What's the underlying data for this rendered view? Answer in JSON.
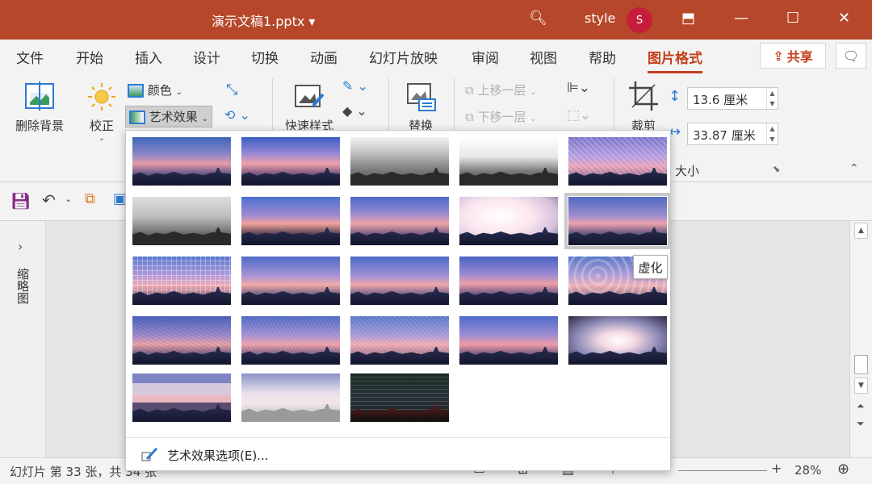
{
  "window": {
    "document_title": "演示文稿1.pptx",
    "title_chevron": "▾",
    "user_name": "style",
    "avatar_initial": "S"
  },
  "tabs": [
    {
      "label": "文件"
    },
    {
      "label": "开始"
    },
    {
      "label": "插入"
    },
    {
      "label": "设计"
    },
    {
      "label": "切换"
    },
    {
      "label": "动画"
    },
    {
      "label": "幻灯片放映"
    },
    {
      "label": "审阅"
    },
    {
      "label": "视图"
    },
    {
      "label": "帮助"
    },
    {
      "label": "图片格式",
      "active": true
    }
  ],
  "share_label": "共享",
  "ribbon": {
    "remove_background": "删除背景",
    "corrections": "校正",
    "color": "颜色",
    "artistic_effects": "艺术效果",
    "quick_styles": "快速样式",
    "replace": "替换",
    "bring_forward": "上移一层",
    "send_backward": "下移一层",
    "crop": "裁剪",
    "height_value": "13.6 厘米",
    "width_value": "33.87 厘米",
    "size_group": "大小"
  },
  "left_pane": {
    "label": "缩略图"
  },
  "status": {
    "slide_info": "幻灯片 第 33 张，共 34 张",
    "zoom": "28%"
  },
  "artistic_menu": {
    "options_label": "艺术效果选项(E)...",
    "tooltip": "虚化",
    "effects": [
      {
        "style": "none"
      },
      {
        "style": "marker"
      },
      {
        "style": "pencil-gray"
      },
      {
        "style": "pencil-sketch"
      },
      {
        "style": "line-drawing"
      },
      {
        "style": "chalk"
      },
      {
        "style": "paint-strokes"
      },
      {
        "style": "paint-brush"
      },
      {
        "style": "glow-diffused"
      },
      {
        "style": "blur",
        "selected": true
      },
      {
        "style": "light-screen"
      },
      {
        "style": "watercolor"
      },
      {
        "style": "cutout-sponge"
      },
      {
        "style": "film-grain"
      },
      {
        "style": "glass"
      },
      {
        "style": "cement"
      },
      {
        "style": "texturizer"
      },
      {
        "style": "crisscross"
      },
      {
        "style": "pastels"
      },
      {
        "style": "plastic-wrap"
      },
      {
        "style": "cutout"
      },
      {
        "style": "photocopy"
      },
      {
        "style": "glow-edges"
      }
    ]
  },
  "colors": {
    "accent": "#b7472a",
    "active_tab": "#c43e1c"
  }
}
